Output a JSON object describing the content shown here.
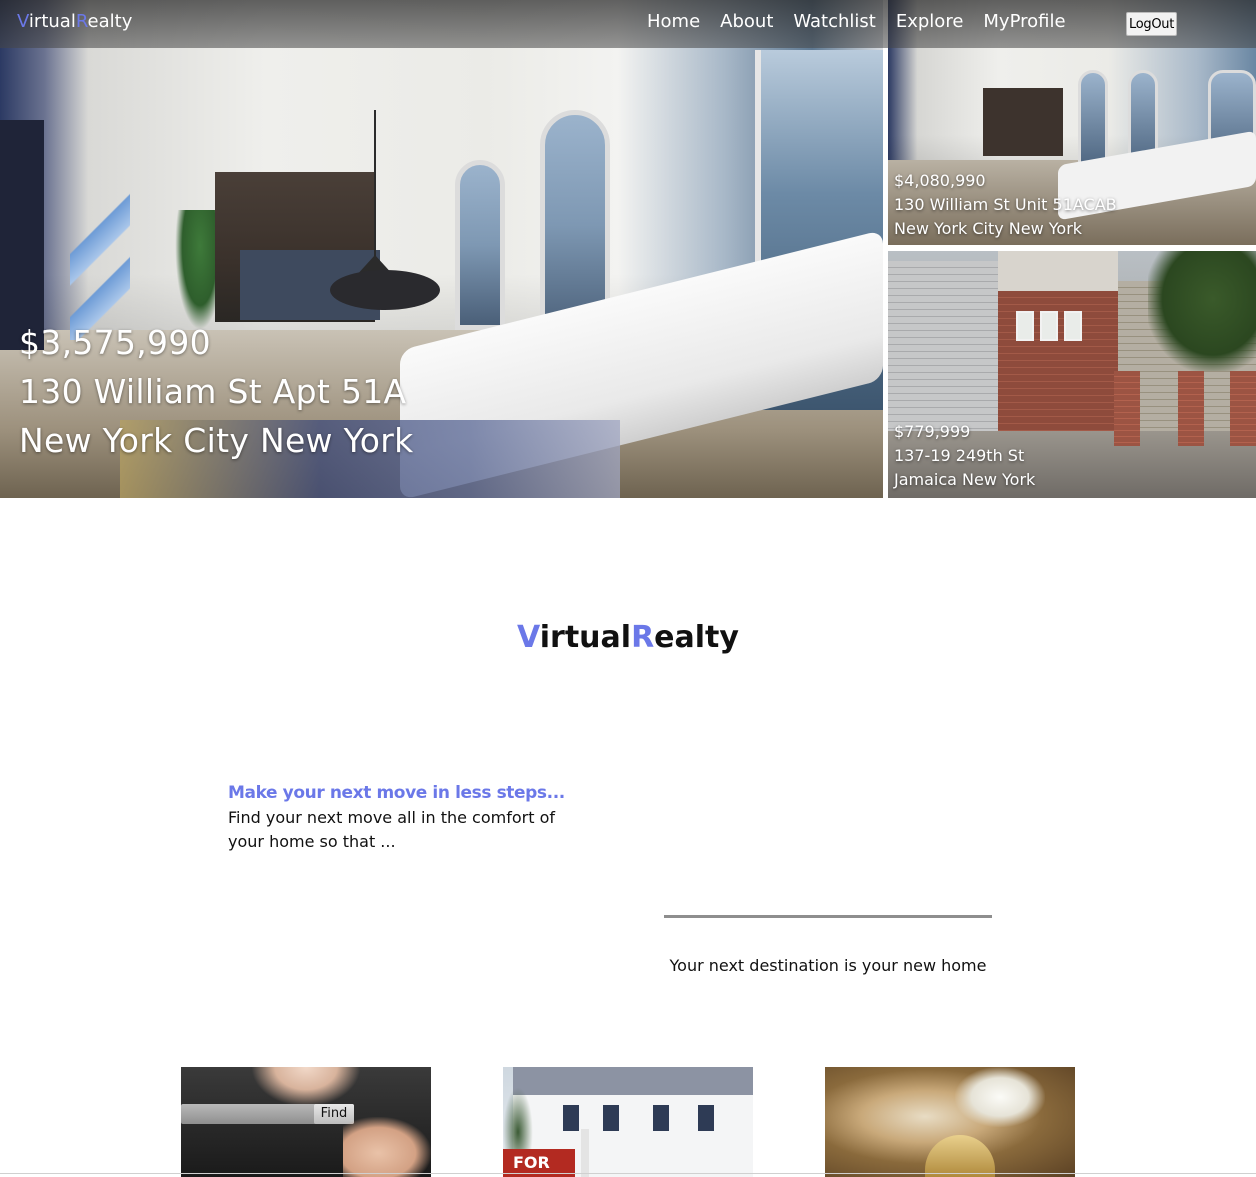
{
  "navbar": {
    "brand_first": "V",
    "brand_mid": "irtual",
    "brand_second": "R",
    "brand_rest": "ealty",
    "links": [
      {
        "label": "Home"
      },
      {
        "label": "About"
      },
      {
        "label": "Watchlist"
      },
      {
        "label": "Explore"
      },
      {
        "label": "MyProfile"
      }
    ],
    "logout_label": "LogOut"
  },
  "hero": {
    "main": {
      "price": "$3,575,990",
      "address": "130 William St Apt 51A",
      "city": "New York City New York"
    },
    "side": [
      {
        "price": "$4,080,990",
        "address": "130 William St Unit 51ACAB",
        "city": "New York City New York"
      },
      {
        "price": "$779,999",
        "address": "137-19 249th St",
        "city": "Jamaica New York"
      }
    ]
  },
  "about": {
    "logo_first": "V",
    "logo_mid": "irtual",
    "logo_second": "R",
    "logo_rest": "ealty",
    "tagline_heading": "Make your next move in less steps...",
    "tagline_body": "Find your next move all in the comfort of your home so that ...",
    "destination": "Your next destination is your new home"
  },
  "cards": {
    "find_label": "Find",
    "sign_text": "FOR"
  },
  "colors": {
    "accent": "#6b78e8",
    "navbar_bg": "#464646"
  }
}
